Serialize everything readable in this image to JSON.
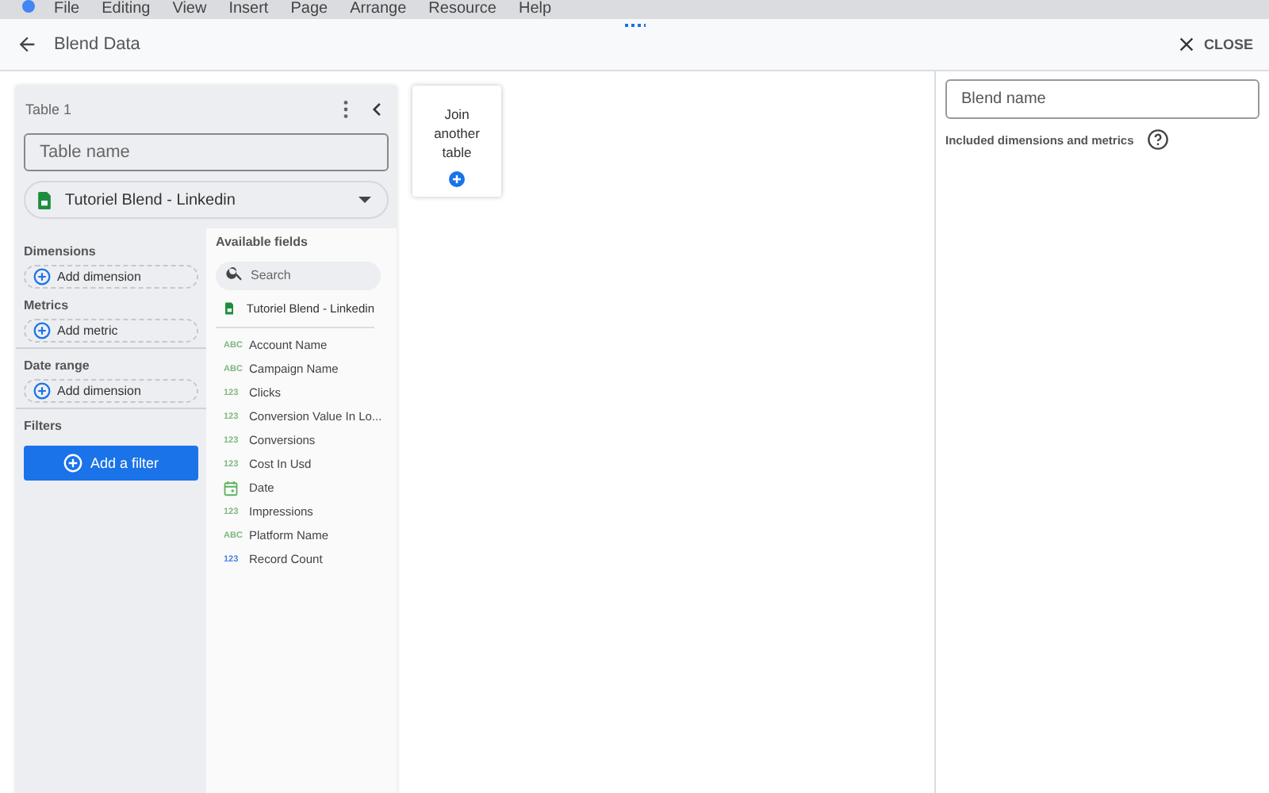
{
  "menu": [
    "File",
    "Editing",
    "View",
    "Insert",
    "Page",
    "Arrange",
    "Resource",
    "Help"
  ],
  "header": {
    "title": "Blend Data",
    "close": "CLOSE"
  },
  "table": {
    "title": "Table 1",
    "name_placeholder": "Table name",
    "source": "Tutoriel Blend - Linkedin",
    "sections": [
      {
        "kind": "slot",
        "title": "Dimensions",
        "button": "Add dimension"
      },
      {
        "kind": "slot",
        "title": "Metrics",
        "button": "Add metric"
      },
      {
        "kind": "slot",
        "title": "Date range",
        "button": "Add dimension"
      },
      {
        "kind": "filter",
        "title": "Filters",
        "button": "Add a filter"
      }
    ],
    "available": {
      "title": "Available fields",
      "search_placeholder": "Search",
      "source": "Tutoriel Blend - Linkedin",
      "fields": [
        {
          "kind": "text",
          "type_label": "ABC",
          "name": "Account Name"
        },
        {
          "kind": "text",
          "type_label": "ABC",
          "name": "Campaign Name"
        },
        {
          "kind": "number",
          "type_label": "123",
          "name": "Clicks"
        },
        {
          "kind": "number",
          "type_label": "123",
          "name": "Conversion Value In Lo..."
        },
        {
          "kind": "number",
          "type_label": "123",
          "name": "Conversions"
        },
        {
          "kind": "number",
          "type_label": "123",
          "name": "Cost In Usd"
        },
        {
          "kind": "date",
          "name": "Date"
        },
        {
          "kind": "number",
          "type_label": "123",
          "name": "Impressions"
        },
        {
          "kind": "text",
          "type_label": "ABC",
          "name": "Platform Name"
        },
        {
          "kind": "count",
          "type_label": "123",
          "name": "Record Count"
        }
      ]
    }
  },
  "join": {
    "label": "Join another table"
  },
  "blend": {
    "name_placeholder": "Blend name",
    "included_label": "Included dimensions and metrics"
  }
}
